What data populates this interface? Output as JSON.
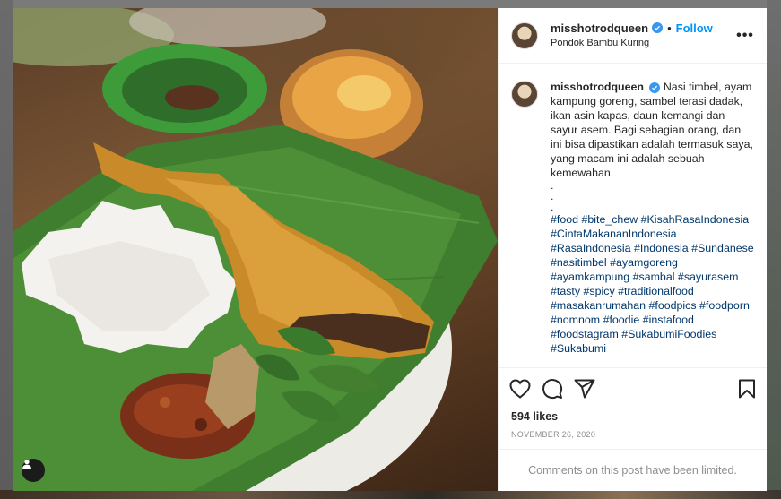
{
  "post": {
    "username": "misshotrodqueen",
    "follow_label": "Follow",
    "dot": "•",
    "location": "Pondok Bambu Kuring",
    "more_label": "•••",
    "caption": "Nasi timbel, ayam kampung goreng, sambel terasi dadak, ikan asin kapas, daun kemangi dan sayur asem. Bagi sebagian orang, dan ini bisa dipastikan adalah termasuk saya, yang macam ini adalah sebuah kemewahan.",
    "dots": [
      ".",
      ".",
      "."
    ],
    "hashtags": [
      "#food",
      "#bite_chew",
      "#KisahRasaIndonesia",
      "#CintaMakananIndonesia",
      "#RasaIndonesia",
      "#Indonesia",
      "#Sundanese",
      "#nasitimbel",
      "#ayamgoreng",
      "#ayamkampung",
      "#sambal",
      "#sayurasem",
      "#tasty",
      "#spicy",
      "#traditionalfood",
      "#masakanrumahan",
      "#foodpics",
      "#foodporn",
      "#nomnom",
      "#foodie",
      "#instafood",
      "#foodstagram",
      "#SukabumiFoodies",
      "#Sukabumi"
    ],
    "likes": "594 likes",
    "date": "NOVEMBER 26, 2020",
    "comments_limited": "Comments on this post have been limited."
  },
  "icons": {
    "verified": "verified-badge-icon",
    "like": "heart-icon",
    "comment": "comment-bubble-icon",
    "share": "paper-plane-icon",
    "save": "bookmark-icon",
    "user_overlay": "user-silhouette-icon"
  },
  "colors": {
    "accent": "#0095f6",
    "verified": "#3897f0",
    "hashtag": "#00376b",
    "muted": "#8e8e8e"
  }
}
